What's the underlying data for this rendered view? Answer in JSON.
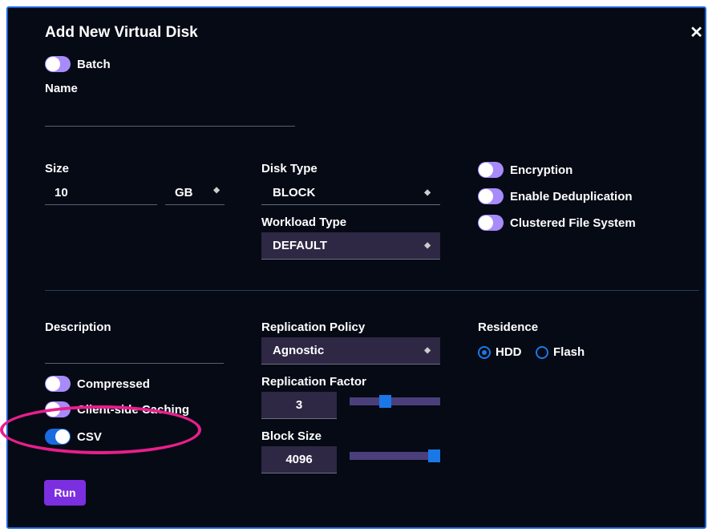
{
  "dialog": {
    "title": "Add New Virtual Disk",
    "close_icon": "close-icon"
  },
  "batch": {
    "label": "Batch",
    "checked": false
  },
  "name": {
    "label": "Name",
    "value": ""
  },
  "size": {
    "label": "Size",
    "value": "10",
    "unit": "GB"
  },
  "disk_type": {
    "label": "Disk Type",
    "value": "BLOCK"
  },
  "workload_type": {
    "label": "Workload Type",
    "value": "DEFAULT"
  },
  "toggles_right": [
    {
      "label": "Encryption",
      "checked": false
    },
    {
      "label": "Enable Deduplication",
      "checked": false
    },
    {
      "label": "Clustered File System",
      "checked": false
    }
  ],
  "description": {
    "label": "Description",
    "value": ""
  },
  "toggles_left": [
    {
      "label": "Compressed",
      "checked": false
    },
    {
      "label": "Client-side Caching",
      "checked": false
    },
    {
      "label": "CSV",
      "checked": true
    }
  ],
  "replication_policy": {
    "label": "Replication Policy",
    "value": "Agnostic"
  },
  "replication_factor": {
    "label": "Replication Factor",
    "value": "3",
    "slider_fraction": 0.38
  },
  "block_size": {
    "label": "Block Size",
    "value": "4096",
    "slider_fraction": 1.0
  },
  "residence": {
    "label": "Residence",
    "options": [
      "HDD",
      "Flash"
    ],
    "selected": "HDD"
  },
  "run_button": {
    "label": "Run"
  },
  "colors": {
    "accent": "#1a78e6",
    "toggle_off": "#a78bfa",
    "run": "#7c2fe0",
    "highlight": "#e91e8c",
    "background": "#050a15"
  }
}
